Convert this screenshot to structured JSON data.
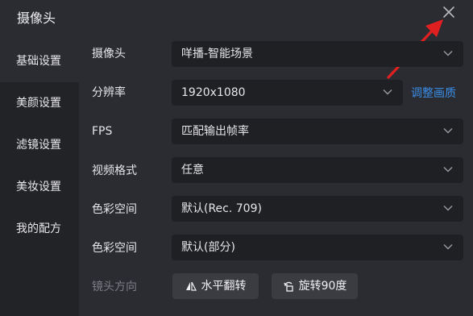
{
  "dialog": {
    "title": "摄像头"
  },
  "sidebar": {
    "items": [
      {
        "label": "基础设置",
        "active": true
      },
      {
        "label": "美颜设置",
        "active": false
      },
      {
        "label": "滤镜设置",
        "active": false
      },
      {
        "label": "美妆设置",
        "active": false
      },
      {
        "label": "我的配方",
        "active": false
      }
    ]
  },
  "form": {
    "camera": {
      "label": "摄像头",
      "value": "咩播-智能场景"
    },
    "resolution": {
      "label": "分辨率",
      "value": "1920x1080",
      "link": "调整画质"
    },
    "fps": {
      "label": "FPS",
      "value": "匹配输出帧率"
    },
    "video_format": {
      "label": "视频格式",
      "value": "任意"
    },
    "color_space": {
      "label": "色彩空间",
      "value": "默认(Rec. 709)"
    },
    "color_range": {
      "label": "色彩空间",
      "value": "默认(部分)"
    },
    "lens_direction": {
      "label": "镜头方向",
      "flip_label": "水平翻转",
      "rotate_label": "旋转90度"
    }
  },
  "colors": {
    "accent": "#3a8ee6",
    "annotation_arrow": "#e02020",
    "background": "#2b2c32",
    "sidebar": "#222327",
    "field": "#1f2024"
  },
  "icons": {
    "close": "close-icon",
    "chevron": "chevron-down-icon",
    "flip": "flip-horizontal-icon",
    "rotate": "rotate-icon"
  }
}
